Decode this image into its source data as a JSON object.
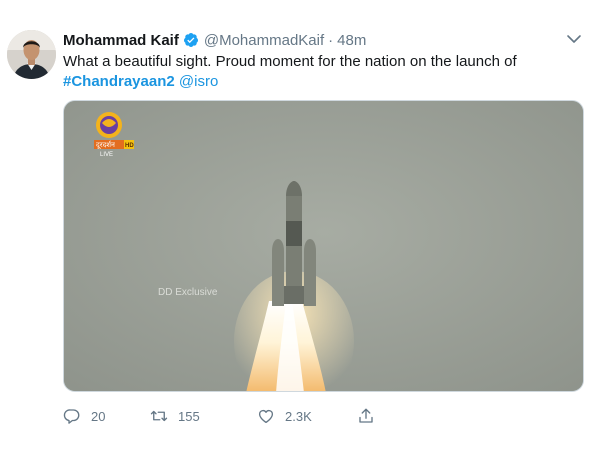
{
  "tweet": {
    "author_name": "Mohammad Kaif",
    "handle": "@MohammadKaif",
    "separator": "·",
    "time": "48m",
    "text_before": "What a beautiful sight. Proud moment for the nation on the launch of ",
    "hashtag": "#Chandrayaan2",
    "mention": "@isro",
    "media": {
      "channel_text": "दूरदर्शन",
      "hd_label": "HD",
      "live_label": "LIVE",
      "watermark": "DD Exclusive"
    },
    "actions": {
      "reply_count": "20",
      "retweet_count": "155",
      "like_count": "2.3K"
    },
    "icons": [
      "verified-icon",
      "caret-down-icon",
      "reply-icon",
      "retweet-icon",
      "like-icon",
      "share-icon"
    ],
    "colors": {
      "link": "#1b95e0",
      "secondary": "#657786",
      "verified": "#1da1f2"
    }
  }
}
